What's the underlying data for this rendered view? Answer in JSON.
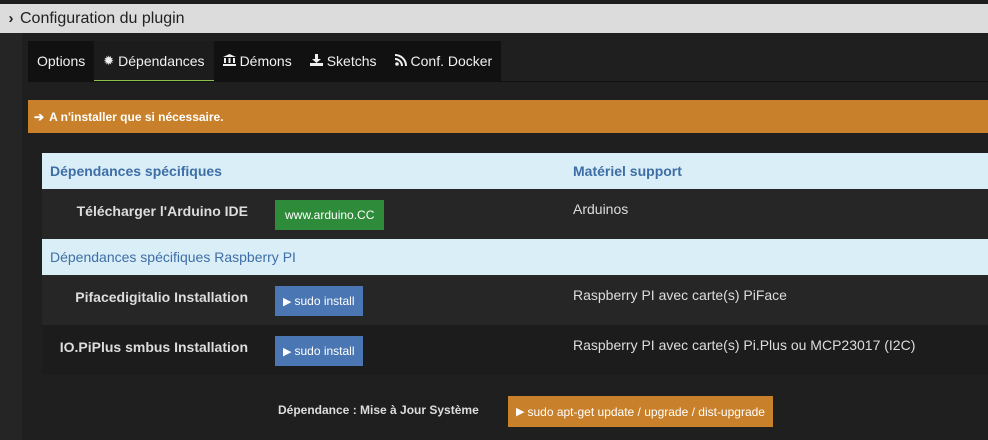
{
  "header": {
    "title": "Configuration du plugin"
  },
  "tabs": [
    {
      "label": "Options",
      "icon": ""
    },
    {
      "label": "Dépendances",
      "icon": "gear-icon"
    },
    {
      "label": "Démons",
      "icon": "bank-icon"
    },
    {
      "label": "Sketchs",
      "icon": "download-icon"
    },
    {
      "label": "Conf. Docker",
      "icon": "rss-icon"
    }
  ],
  "alert": {
    "text": "A n'installer que si nécessaire."
  },
  "table": {
    "col1_header": "Dépendances spécifiques",
    "col2_header": "Matériel support",
    "rows": [
      {
        "label": "Télécharger l'Arduino IDE",
        "button": "www.arduino.CC",
        "material": "Arduinos"
      }
    ],
    "section2_header": "Dépendances spécifiques Raspberry PI",
    "rows2": [
      {
        "label": "Pifacedigitalio Installation",
        "button": "sudo install",
        "material": "Raspberry PI avec carte(s) PiFace"
      },
      {
        "label": "IO.PiPlus smbus Installation",
        "button": "sudo install",
        "material": "Raspberry PI avec carte(s) Pi.Plus ou MCP23017 (I2C)"
      }
    ]
  },
  "footer": {
    "label": "Dépendance : Mise à Jour Système",
    "button": "sudo apt-get update / upgrade / dist-upgrade"
  },
  "colors": {
    "accent_orange": "#c9802a",
    "green": "#2e8b3a",
    "blue": "#4a76b4",
    "header_bg": "#d9eef7"
  }
}
